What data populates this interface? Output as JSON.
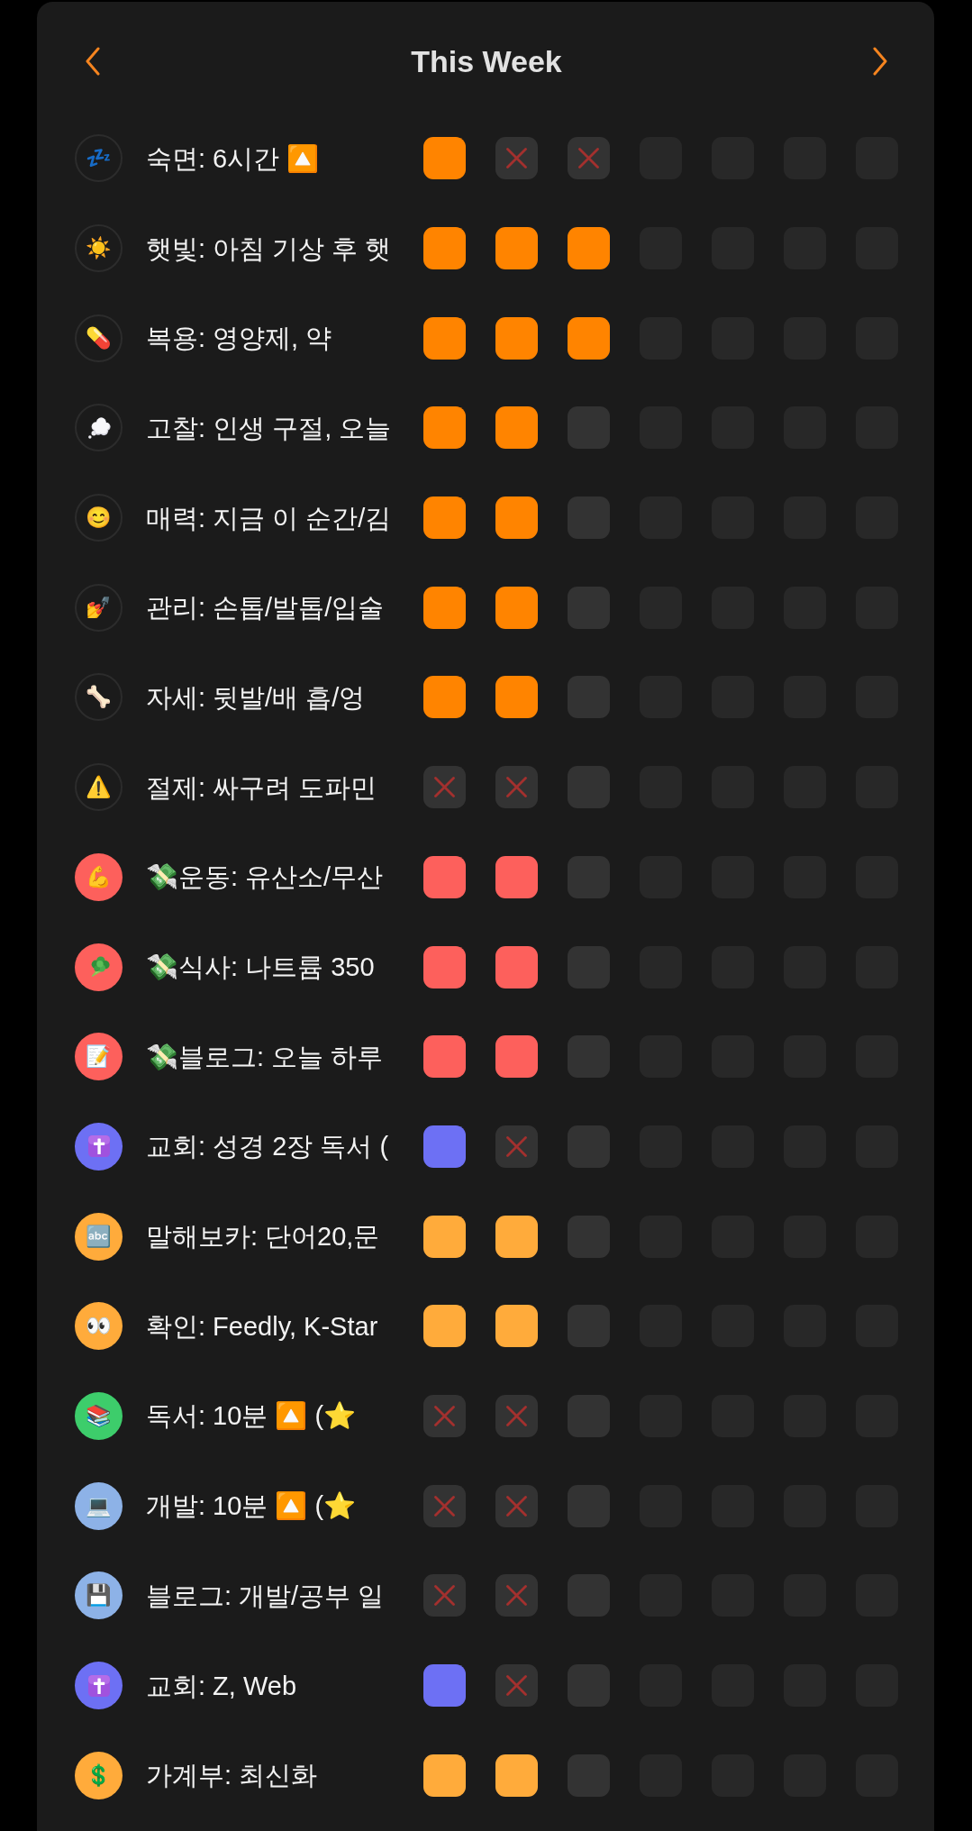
{
  "header": {
    "title": "This Week"
  },
  "habits": [
    {
      "icon": "💤",
      "icon_filled": false,
      "color": "#ff8400",
      "label": "숙면: 6시간 🔼",
      "days": [
        {
          "kind": "done"
        },
        {
          "kind": "missed"
        },
        {
          "kind": "missed"
        },
        {
          "kind": "future"
        },
        {
          "kind": "future"
        },
        {
          "kind": "future"
        },
        {
          "kind": "future"
        }
      ]
    },
    {
      "icon": "☀️",
      "icon_filled": false,
      "color": "#ff8400",
      "label": "햇빛: 아침 기상 후 햇",
      "days": [
        {
          "kind": "done"
        },
        {
          "kind": "done"
        },
        {
          "kind": "done"
        },
        {
          "kind": "future"
        },
        {
          "kind": "future"
        },
        {
          "kind": "future"
        },
        {
          "kind": "future"
        }
      ]
    },
    {
      "icon": "💊",
      "icon_filled": false,
      "color": "#ff8400",
      "label": "복용: 영양제, 약",
      "days": [
        {
          "kind": "done"
        },
        {
          "kind": "done"
        },
        {
          "kind": "done"
        },
        {
          "kind": "future"
        },
        {
          "kind": "future"
        },
        {
          "kind": "future"
        },
        {
          "kind": "future"
        }
      ]
    },
    {
      "icon_filled": false,
      "color": "#ff8400",
      "label": "고찰: 인생 구절, 오늘",
      "days": [
        {
          "kind": "done"
        },
        {
          "kind": "done"
        },
        {
          "kind": "empty"
        },
        {
          "kind": "future"
        },
        {
          "kind": "future"
        },
        {
          "kind": "future"
        },
        {
          "kind": "future"
        }
      ]
    },
    {
      "icon": "😊",
      "icon_filled": false,
      "color": "#ff8400",
      "label": "매력: 지금 이 순간/김",
      "days": [
        {
          "kind": "done"
        },
        {
          "kind": "done"
        },
        {
          "kind": "empty"
        },
        {
          "kind": "future"
        },
        {
          "kind": "future"
        },
        {
          "kind": "future"
        },
        {
          "kind": "future"
        }
      ]
    },
    {
      "icon": "💅",
      "icon_filled": false,
      "color": "#ff8400",
      "label": "관리: 손톱/발톱/입술",
      "days": [
        {
          "kind": "done"
        },
        {
          "kind": "done"
        },
        {
          "kind": "empty"
        },
        {
          "kind": "future"
        },
        {
          "kind": "future"
        },
        {
          "kind": "future"
        },
        {
          "kind": "future"
        }
      ]
    },
    {
      "icon": "🦴",
      "icon_filled": false,
      "color": "#ff8400",
      "label": "자세: 뒷발/배 흡/엉",
      "days": [
        {
          "kind": "done"
        },
        {
          "kind": "done"
        },
        {
          "kind": "empty"
        },
        {
          "kind": "future"
        },
        {
          "kind": "future"
        },
        {
          "kind": "future"
        },
        {
          "kind": "future"
        }
      ]
    },
    {
      "icon": "⚠️",
      "icon_filled": false,
      "label": "절제: 싸구려 도파민",
      "days": [
        {
          "kind": "missed"
        },
        {
          "kind": "missed"
        },
        {
          "kind": "empty"
        },
        {
          "kind": "future"
        },
        {
          "kind": "future"
        },
        {
          "kind": "future"
        },
        {
          "kind": "future"
        }
      ]
    },
    {
      "icon": "💪",
      "icon_filled": true,
      "color": "#fd605c",
      "label": "💸운동: 유산소/무산",
      "days": [
        {
          "kind": "done"
        },
        {
          "kind": "done"
        },
        {
          "kind": "empty"
        },
        {
          "kind": "future"
        },
        {
          "kind": "future"
        },
        {
          "kind": "future"
        },
        {
          "kind": "future"
        }
      ]
    },
    {
      "icon_filled": true,
      "color": "#fd605c",
      "label": "💸식사: 나트륨 350",
      "days": [
        {
          "kind": "done"
        },
        {
          "kind": "done"
        },
        {
          "kind": "empty"
        },
        {
          "kind": "future"
        },
        {
          "kind": "future"
        },
        {
          "kind": "future"
        },
        {
          "kind": "future"
        }
      ]
    },
    {
      "icon": "📝",
      "icon_filled": true,
      "color": "#fd605c",
      "label": "💸블로그: 오늘 하루",
      "days": [
        {
          "kind": "done"
        },
        {
          "kind": "done"
        },
        {
          "kind": "empty"
        },
        {
          "kind": "future"
        },
        {
          "kind": "future"
        },
        {
          "kind": "future"
        },
        {
          "kind": "future"
        }
      ]
    },
    {
      "icon_filled": true,
      "color": "#6d70f4",
      "label": "교회: 성경 2장 독서 (",
      "days": [
        {
          "kind": "done"
        },
        {
          "kind": "missed"
        },
        {
          "kind": "empty"
        },
        {
          "kind": "future"
        },
        {
          "kind": "future"
        },
        {
          "kind": "future"
        },
        {
          "kind": "future"
        }
      ]
    },
    {
      "icon": "🔤",
      "icon_filled": true,
      "color": "#ffab3b",
      "label": "말해보카: 단어20,문",
      "days": [
        {
          "kind": "done"
        },
        {
          "kind": "done"
        },
        {
          "kind": "empty"
        },
        {
          "kind": "future"
        },
        {
          "kind": "future"
        },
        {
          "kind": "future"
        },
        {
          "kind": "future"
        }
      ]
    },
    {
      "icon": "👀",
      "icon_filled": true,
      "color": "#ffab3b",
      "label": "확인: Feedly, K-Star",
      "days": [
        {
          "kind": "done"
        },
        {
          "kind": "done"
        },
        {
          "kind": "empty"
        },
        {
          "kind": "future"
        },
        {
          "kind": "future"
        },
        {
          "kind": "future"
        },
        {
          "kind": "future"
        }
      ]
    },
    {
      "icon": "📚",
      "icon_filled": true,
      "color": "#3dcd6b",
      "label": "독서: 10분 🔼 (⭐",
      "days": [
        {
          "kind": "missed"
        },
        {
          "kind": "missed"
        },
        {
          "kind": "empty"
        },
        {
          "kind": "future"
        },
        {
          "kind": "future"
        },
        {
          "kind": "future"
        },
        {
          "kind": "future"
        }
      ]
    },
    {
      "icon": "💻",
      "icon_filled": true,
      "color": "#8db2e7",
      "label": "개발: 10분 🔼 (⭐",
      "days": [
        {
          "kind": "missed"
        },
        {
          "kind": "missed"
        },
        {
          "kind": "empty"
        },
        {
          "kind": "future"
        },
        {
          "kind": "future"
        },
        {
          "kind": "future"
        },
        {
          "kind": "future"
        }
      ]
    },
    {
      "icon": "💾",
      "icon_filled": true,
      "color": "#8db2e7",
      "label": "블로그: 개발/공부 일",
      "days": [
        {
          "kind": "missed"
        },
        {
          "kind": "missed"
        },
        {
          "kind": "empty"
        },
        {
          "kind": "future"
        },
        {
          "kind": "future"
        },
        {
          "kind": "future"
        },
        {
          "kind": "future"
        }
      ]
    },
    {
      "icon_filled": true,
      "color": "#6d70f4",
      "label": "교회: Z, Web",
      "days": [
        {
          "kind": "done"
        },
        {
          "kind": "missed"
        },
        {
          "kind": "empty"
        },
        {
          "kind": "future"
        },
        {
          "kind": "future"
        },
        {
          "kind": "future"
        },
        {
          "kind": "future"
        }
      ]
    },
    {
      "icon": "💲",
      "icon_filled": true,
      "color": "#ffab3b",
      "label": "가계부: 최신화",
      "days": [
        {
          "kind": "done"
        },
        {
          "kind": "done"
        },
        {
          "kind": "empty"
        },
        {
          "kind": "future"
        },
        {
          "kind": "future"
        },
        {
          "kind": "future"
        },
        {
          "kind": "future"
        }
      ]
    }
  ]
}
